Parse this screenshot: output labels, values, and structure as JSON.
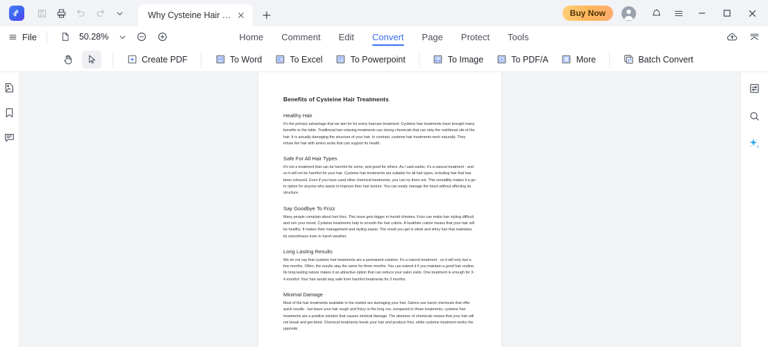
{
  "titlebar": {
    "logo_name": "pdfelement-logo",
    "quick_actions": [
      {
        "name": "save-icon",
        "label": "Save",
        "enabled": false
      },
      {
        "name": "print-icon",
        "label": "Print",
        "enabled": true
      },
      {
        "name": "undo-icon",
        "label": "Undo",
        "enabled": false
      },
      {
        "name": "redo-icon",
        "label": "Redo",
        "enabled": false
      },
      {
        "name": "chevron-down-icon",
        "label": "More quick actions",
        "enabled": true
      }
    ],
    "tab": {
      "title": "Why Cysteine Hair Treat...",
      "close_label": "Close tab"
    },
    "new_tab_label": "New tab",
    "buy_now_label": "Buy Now",
    "account_label": "Account",
    "notifications_label": "Notifications",
    "app_menu_label": "Menu",
    "minimize_label": "Minimize",
    "maximize_label": "Maximize",
    "close_label": "Close"
  },
  "menubar": {
    "file_label": "File",
    "zoom_value": "50.28%",
    "zoom_out_label": "Zoom out",
    "zoom_in_label": "Zoom in",
    "zoom_dropdown_label": "Zoom presets",
    "page_fit_label": "Page fit",
    "tabs": [
      {
        "label": "Home",
        "active": false
      },
      {
        "label": "Comment",
        "active": false
      },
      {
        "label": "Edit",
        "active": false
      },
      {
        "label": "Convert",
        "active": true
      },
      {
        "label": "Page",
        "active": false
      },
      {
        "label": "Protect",
        "active": false
      },
      {
        "label": "Tools",
        "active": false
      }
    ],
    "cloud_upload_label": "Upload to cloud",
    "collapse_ribbon_label": "Collapse ribbon"
  },
  "ribbon": {
    "hand_tool_label": "Hand tool",
    "select_tool_label": "Select tool",
    "items": [
      {
        "label": "Create PDF",
        "icon": "create-pdf-icon"
      },
      {
        "label": "To Word",
        "icon": "to-word-icon"
      },
      {
        "label": "To Excel",
        "icon": "to-excel-icon"
      },
      {
        "label": "To Powerpoint",
        "icon": "to-powerpoint-icon"
      },
      {
        "label": "To Image",
        "icon": "to-image-icon"
      },
      {
        "label": "To PDF/A",
        "icon": "to-pdfa-icon"
      },
      {
        "label": "More",
        "icon": "more-icon"
      },
      {
        "label": "Batch Convert",
        "icon": "batch-convert-icon"
      }
    ]
  },
  "left_rail": [
    {
      "name": "thumbnails-icon",
      "label": "Page Thumbnails"
    },
    {
      "name": "bookmark-icon",
      "label": "Bookmarks"
    },
    {
      "name": "comment-icon",
      "label": "Comments"
    }
  ],
  "right_rail": [
    {
      "name": "properties-icon",
      "label": "Properties"
    },
    {
      "name": "search-icon",
      "label": "Search"
    },
    {
      "name": "ai-sparkle-icon",
      "label": "AI Assistant"
    }
  ],
  "document": {
    "title": "Benefits of Cysteine Hair Treatments",
    "sections": [
      {
        "heading": "Healthy Hair",
        "body": "It's the primary advantage that we aim for for every haircare treatment. Cysteine hair treatments have brought many benefits to the table. Traditional hair relaxing treatments use strong chemicals that can strip the nutritional oils of the hair. It is actually damaging the structure of your hair. In contrast, cysteine hair treatments work naturally. They infuse the hair with amino acids that can support its health."
      },
      {
        "heading": "Safe For All Hair Types",
        "body": "It's not a treatment that can be harmful for some, and good for others. As I said earlier, it's a natural treatment - and so it will not be harmful for your hair. Cysteine hair treatments are suitable for all hair types, including hair that has been coloured. Even if you have used other chemical treatments, you can try them out. This versatility makes it a go-to option for anyone who wants to improve their hair texture. You can easily manage the heart without affecting its structure."
      },
      {
        "heading": "Say Goodbye To Frizz",
        "body": "Many people complain about hair frizz. This issue gets bigger in humid climates. Frizz can make hair styling difficult and ruin your mood. Cysteine treatments help to smooth the hair cuticle. A healthier cuticle means that your hair will be healthy. It makes their management and styling easier. The result you get is sleek and shiny hair that maintains its smoothness even in harsh weather."
      },
      {
        "heading": "Long Lasting Results",
        "body": "We do not say that cysteine hair treatments are a permanent solution. It's a natural treatment - so it will only last a few months. Often, the results stay the same for three months. You can extend it if you maintain a good hair routine. Its long-lasting nature makes it an attractive option that can reduce your salon visits. One treatment is enough for 3-4 months! Your hair would stay safe from harmful treatments for 3 months."
      },
      {
        "heading": "Minimal Damage",
        "body": "Most of the hair treatments available in the market are damaging your hair. Salons use harsh chemicals that offer quick results - but leave your hair rough and frizzy in the long run; compared to these treatments, cysteine hair treatments are a positive solution that causes minimal damage. The absence of chemicals means that your hair will not break and get dried. Chemical treatments break your hair and produce frizz, while cysteine treatment works the opposite."
      }
    ]
  },
  "colors": {
    "accent_blue": "#3b6ef2",
    "buy_now_gradient_start": "#ffcf7a",
    "buy_now_gradient_end": "#ffaa6b",
    "titlebar_bg": "#f1f3f6",
    "canvas_bg": "#f2f3f5"
  }
}
